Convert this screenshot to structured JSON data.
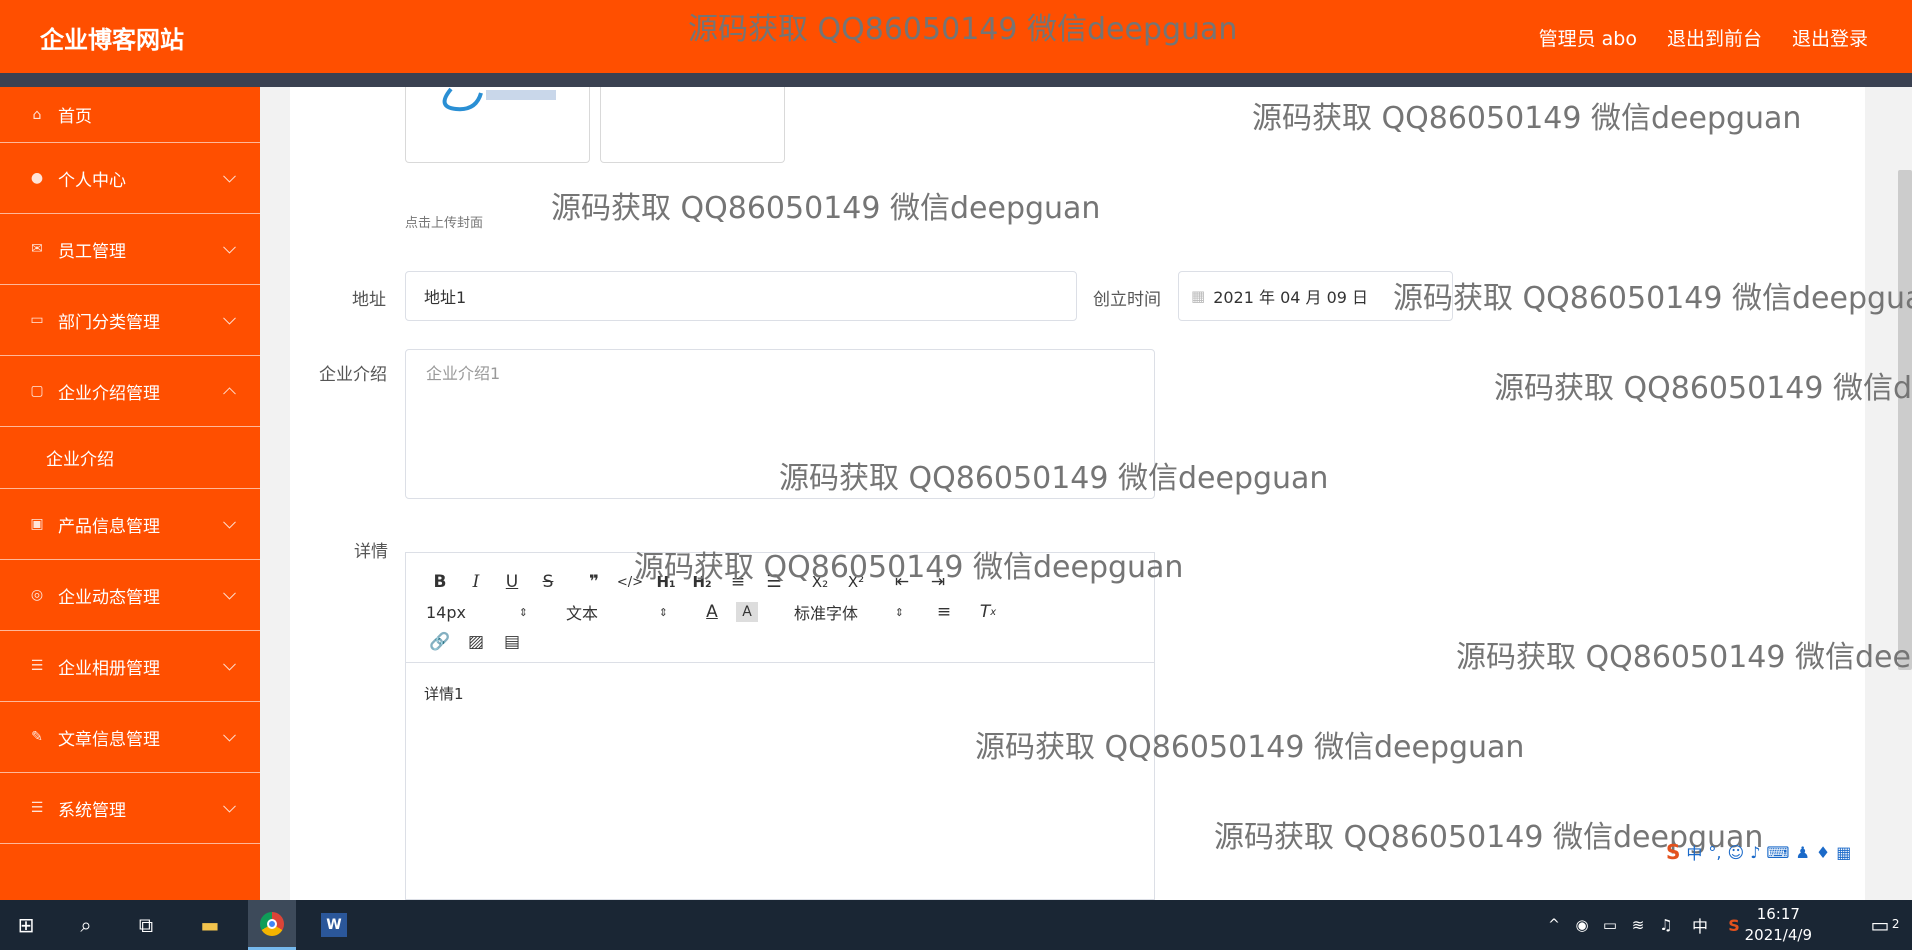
{
  "header": {
    "site_title": "企业博客网站",
    "admin_label": "管理员 abo",
    "to_front_label": "退出到前台",
    "logout_label": "退出登录"
  },
  "sidebar": {
    "items": [
      {
        "label": "首页",
        "icon": "home-icon"
      },
      {
        "label": "个人中心",
        "icon": "user-icon"
      },
      {
        "label": "员工管理",
        "icon": "mail-icon"
      },
      {
        "label": "部门分类管理",
        "icon": "message-icon"
      },
      {
        "label": "企业介绍管理",
        "icon": "chat-icon"
      },
      {
        "label": "企业介绍"
      },
      {
        "label": "产品信息管理",
        "icon": "wallet-icon"
      },
      {
        "label": "企业动态管理",
        "icon": "target-icon"
      },
      {
        "label": "企业相册管理",
        "icon": "list-icon"
      },
      {
        "label": "文章信息管理",
        "icon": "edit-icon"
      },
      {
        "label": "系统管理",
        "icon": "list-icon"
      }
    ]
  },
  "form": {
    "cover_hint": "点击上传封面",
    "address_label": "地址",
    "address_value": "地址1",
    "created_label": "创立时间",
    "created_value": "2021 年 04 月 09 日",
    "intro_label": "企业介绍",
    "intro_value": "企业介绍1",
    "detail_label": "详情",
    "detail_value": "详情1"
  },
  "editor_toolbar": {
    "font_size": "14px",
    "text_type": "文本",
    "font_family": "标准字体"
  },
  "watermark": "源码获取 QQ86050149 微信deepguan",
  "taskbar": {
    "time": "16:17",
    "date": "2021/4/9",
    "ime_lang": "中",
    "notification_count": "2"
  },
  "colors": {
    "brand": "#ff4f00",
    "header_strip": "#3a4151",
    "taskbar": "#1a2634"
  }
}
